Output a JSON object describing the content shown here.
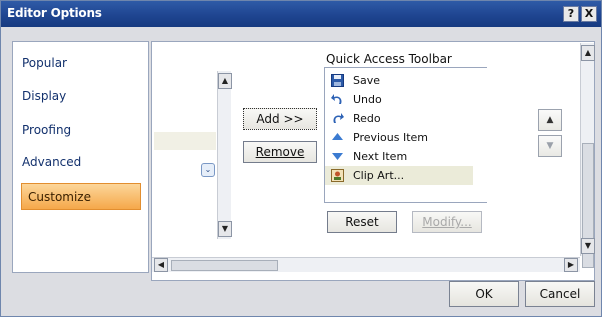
{
  "window": {
    "title": "Editor Options",
    "help_glyph": "?",
    "close_glyph": "X"
  },
  "nav": {
    "items": [
      {
        "label": "Popular"
      },
      {
        "label": "Display"
      },
      {
        "label": "Proofing"
      },
      {
        "label": "Advanced"
      },
      {
        "label": "Customize",
        "selected": true
      }
    ]
  },
  "center_buttons": {
    "add_label": "Add >>",
    "remove_label": "Remove"
  },
  "qat": {
    "title": "Quick Access Toolbar",
    "items": [
      {
        "label": "Save",
        "icon": "save-icon"
      },
      {
        "label": "Undo",
        "icon": "undo-icon"
      },
      {
        "label": "Redo",
        "icon": "redo-icon"
      },
      {
        "label": "Previous Item",
        "icon": "previous-item-icon"
      },
      {
        "label": "Next Item",
        "icon": "next-item-icon"
      },
      {
        "label": "Clip Art...",
        "icon": "clip-art-icon",
        "selected": true
      }
    ],
    "reset_label": "Reset",
    "modify_label": "Modify..."
  },
  "arrows": {
    "up": "▲",
    "down": "▼",
    "left": "◀",
    "right": "▶"
  },
  "footer": {
    "ok_label": "OK",
    "cancel_label": "Cancel"
  },
  "colors": {
    "title_bar": "#1f4591",
    "selected_nav": "#f5a84a",
    "accent_link": "#13316d"
  }
}
